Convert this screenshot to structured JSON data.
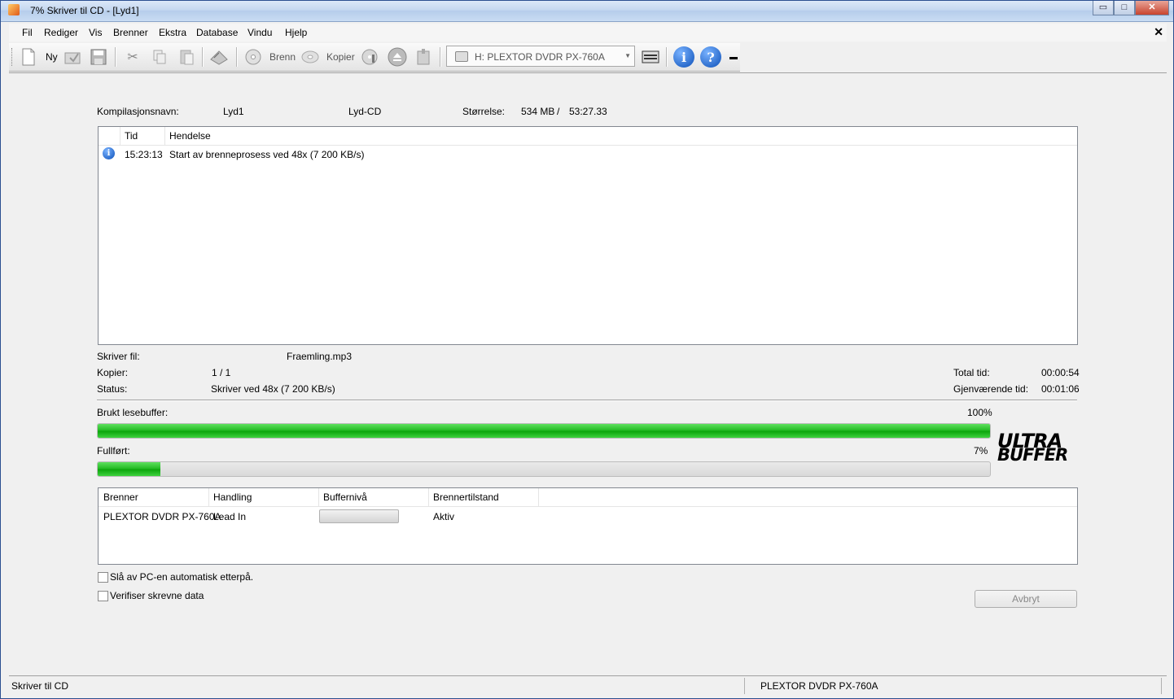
{
  "window": {
    "title": "7% Skriver til CD - [Lyd1]",
    "controls": {
      "minimize": "▭",
      "maximize": "□",
      "close": "✕"
    }
  },
  "menu": {
    "items": [
      "Fil",
      "Rediger",
      "Vis",
      "Brenner",
      "Ekstra",
      "Database",
      "Vindu",
      "Hjelp"
    ],
    "close_label": "✕"
  },
  "toolbar": {
    "new_label": "Ny",
    "burn_label": "Brenn",
    "copy_label": "Kopier",
    "drive_select": "H: PLEXTOR DVDR   PX-760A"
  },
  "compilation": {
    "name_label": "Kompilasjonsnavn:",
    "name_value": "Lyd1",
    "type_value": "Lyd-CD",
    "size_label": "Størrelse:",
    "size_value": "534 MB",
    "size_sep": "/",
    "duration_value": "53:27.33"
  },
  "log": {
    "columns": [
      "Tid",
      "Hendelse"
    ],
    "rows": [
      {
        "icon": "info-icon",
        "time": "15:23:13",
        "event": "Start av brenneprosess ved 48x (7 200 KB/s)"
      }
    ]
  },
  "progress_info": {
    "file_label": "Skriver fil:",
    "file_value": "Fraemling.mp3",
    "copies_label": "Kopier:",
    "copies_value": "1 / 1",
    "status_label": "Status:",
    "status_value": "Skriver ved 48x (7 200 KB/s)",
    "total_time_label": "Total tid:",
    "total_time_value": "00:00:54",
    "remaining_label": "Gjenværende tid:",
    "remaining_value": "00:01:06"
  },
  "buffer": {
    "label": "Brukt lesebuffer:",
    "percent_text": "100%",
    "fraction": 1.0
  },
  "completion": {
    "label": "Fullført:",
    "percent_text": "7%",
    "fraction": 0.07
  },
  "logo": {
    "line1": "ULTRA",
    "line2": "BUFFER"
  },
  "burners": {
    "columns": [
      "Brenner",
      "Handling",
      "Buffernivå",
      "Brennertilstand"
    ],
    "rows": [
      {
        "burner": "PLEXTOR DVDR   PX-760A",
        "action": "Lead In",
        "buffer_fraction": 0.0,
        "state": "Aktiv"
      }
    ]
  },
  "options": {
    "shutdown_label": "Slå av PC-en automatisk etterpå.",
    "shutdown_checked": false,
    "verify_label": "Verifiser skrevne data",
    "verify_checked": false
  },
  "cancel_label": "Avbryt",
  "statusbar": {
    "left": "Skriver til CD",
    "drive": "PLEXTOR  DVDR   PX-760A"
  },
  "colors": {
    "progress_green": "#1fb81f",
    "title_blue": "#c4d7f0"
  }
}
